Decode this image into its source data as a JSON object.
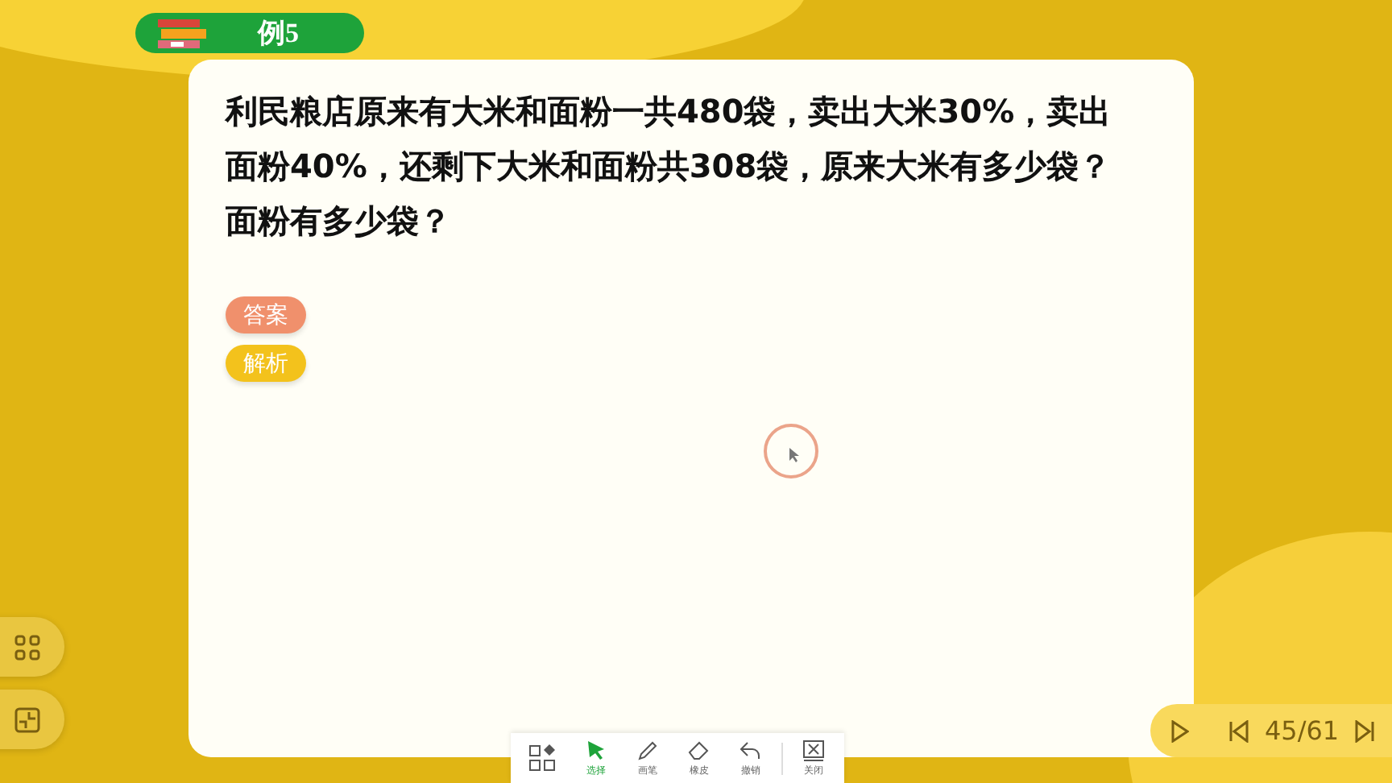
{
  "title_badge": {
    "label": "例5"
  },
  "question": "利民粮店原来有大米和面粉一共480袋，卖出大米30%，卖出面粉40%，还剩下大米和面粉共308袋，原来大米有多少袋？面粉有多少袋？",
  "answer_buttons": [
    {
      "label": "答案",
      "color": "#f0906c"
    },
    {
      "label": "解析",
      "color": "#f3c21c"
    }
  ],
  "toolbar": [
    {
      "kind": "grid",
      "selected": false
    },
    {
      "kind": "select",
      "label": "选择",
      "selected": true
    },
    {
      "kind": "pen",
      "label": "画笔",
      "selected": false
    },
    {
      "kind": "eraser",
      "label": "橡皮",
      "selected": false
    },
    {
      "kind": "undo",
      "label": "撤销",
      "selected": false
    },
    {
      "kind": "close",
      "label": "关闭",
      "selected": false
    }
  ],
  "pager": {
    "page": "45/61"
  }
}
